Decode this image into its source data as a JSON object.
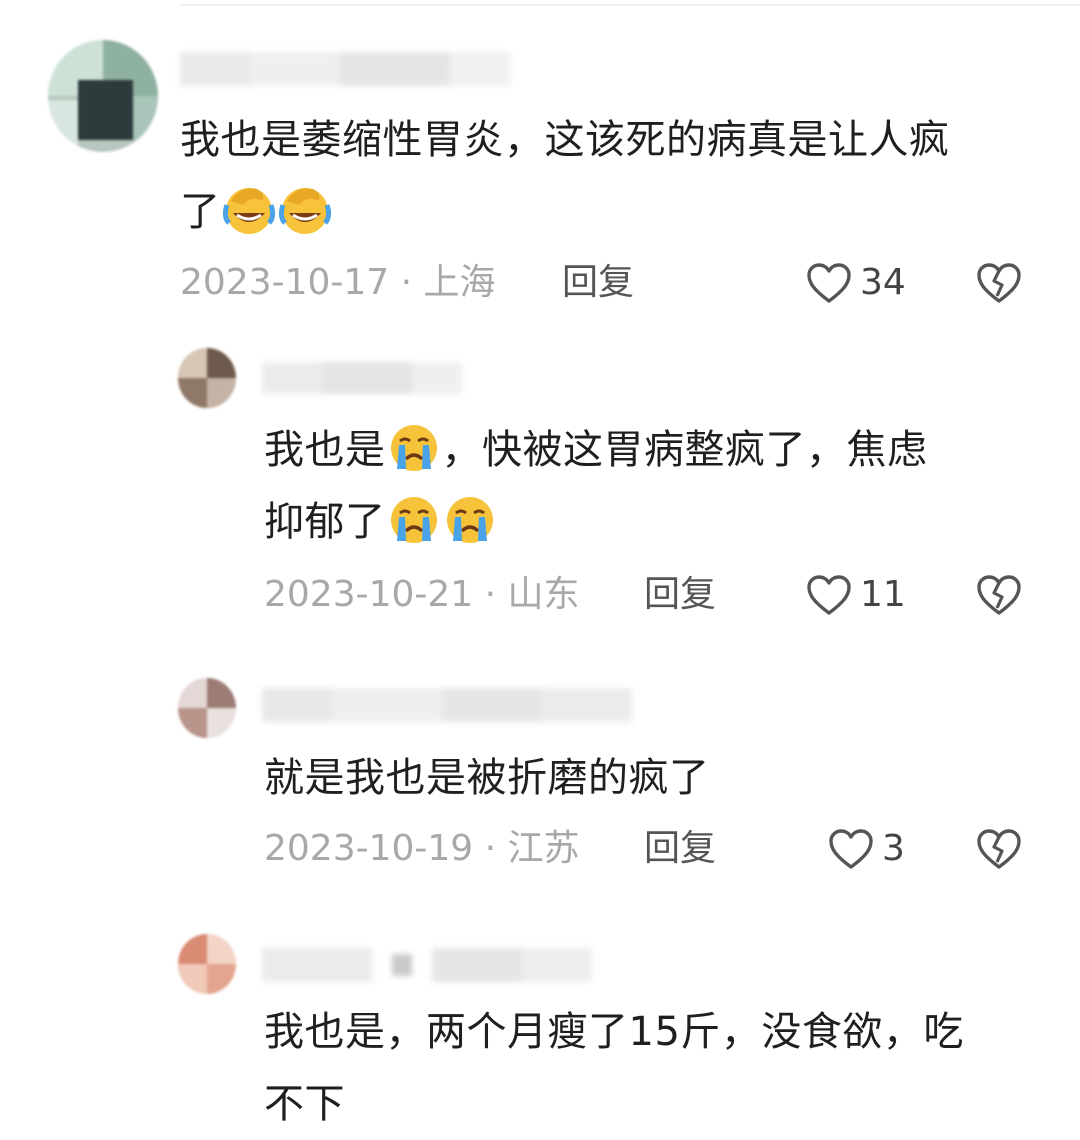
{
  "comments": [
    {
      "text_line1": "我也是萎缩性胃炎，这该死的病真是让人疯",
      "text_line2": "了",
      "emoji_line2": [
        "face-palm-laughing",
        "face-palm-laughing"
      ],
      "date_loc": "2023-10-17 · 上海",
      "reply": "回复",
      "likes": "34"
    },
    {
      "text_seg1": "我也是",
      "emoji_seg1": "crying-face",
      "text_seg2": "，快被这胃病整疯了，焦虑",
      "text_line2": "抑郁了",
      "emoji_line2": [
        "crying-face",
        "crying-face"
      ],
      "date_loc": "2023-10-21 · 山东",
      "reply": "回复",
      "likes": "11"
    },
    {
      "text_line1": "就是我也是被折磨的疯了",
      "date_loc": "2023-10-19 · 江苏",
      "reply": "回复",
      "likes": "3"
    },
    {
      "text_line1": "我也是，两个月瘦了15斤，没食欲，吃",
      "text_line2": "不下"
    }
  ],
  "icons": {
    "like": "heart-outline-icon",
    "dislike": "broken-heart-icon"
  },
  "colors": {
    "text": "#1f1f1f",
    "meta": "#a8a8a8",
    "reply": "#555555",
    "icon": "#555555",
    "emoji_yellow": "#f7c33a",
    "emoji_tear": "#4aa3e8"
  }
}
